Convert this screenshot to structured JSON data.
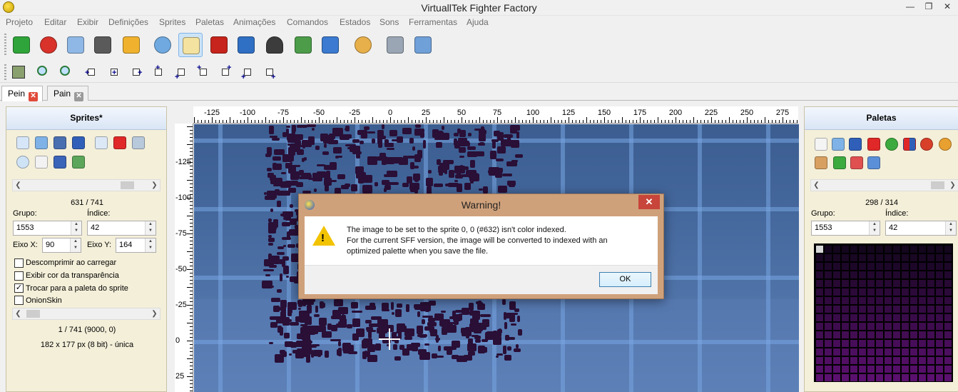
{
  "window": {
    "title": "VirtuallTek Fighter Factory",
    "min_label": "—",
    "max_label": "❐",
    "close_label": "✕"
  },
  "menu": [
    "Projeto",
    "Editar",
    "Exibir",
    "Definições",
    "Sprites",
    "Paletas",
    "Animações",
    "Comandos",
    "Estados",
    "Sons",
    "Ferramentas",
    "Ajuda"
  ],
  "toolbar": {
    "main_icons": [
      "new-icon",
      "close-project-icon",
      "open-icon",
      "save-icon",
      "lock-icon",
      "characters-icon",
      "sprite-editor-icon",
      "animation-clapper-icon",
      "window-icon",
      "joystick-icon",
      "sound-icon",
      "states-icon",
      "palette-icon",
      "tools-icon",
      "settings-icon"
    ],
    "secondary_icons": [
      "calculator-icon",
      "zoom-out-icon",
      "zoom-in-icon",
      "axis-left-icon",
      "axis-center-icon",
      "axis-right-icon",
      "axis-top-left-icon",
      "axis-bottom-left-icon",
      "axis-top-icon",
      "axis-top-right-icon",
      "axis-bottom-icon",
      "axis-bottom-right-icon"
    ]
  },
  "tabs": [
    {
      "label": "Pein",
      "active": true
    },
    {
      "label": "Pain",
      "active": false
    }
  ],
  "sprites_panel": {
    "title": "Sprites*",
    "counter": "631 / 741",
    "group_label": "Grupo:",
    "group_value": "1553",
    "index_label": "Índice:",
    "index_value": "42",
    "axis_x_label": "Eixo X:",
    "axis_x_value": "90",
    "axis_y_label": "Eixo Y:",
    "axis_y_value": "164",
    "checkboxes": [
      {
        "label": "Descomprimir ao carregar",
        "checked": false
      },
      {
        "label": "Exibir cor da transparência",
        "checked": false
      },
      {
        "label": "Trocar para a paleta do sprite",
        "checked": true
      },
      {
        "label": "OnionSkin",
        "checked": false
      }
    ],
    "onion_info": "1 / 741 (9000, 0)",
    "size_info": "182 x 177 px (8 bit) - única"
  },
  "palettes_panel": {
    "title": "Paletas",
    "counter": "298 / 314",
    "group_label": "Grupo:",
    "group_value": "1553",
    "index_label": "Índice:",
    "index_value": "42"
  },
  "rulers": {
    "top": [
      "-125",
      "-100",
      "-75",
      "-50",
      "-25",
      "0",
      "25",
      "50",
      "75",
      "100",
      "125",
      "150",
      "175",
      "200",
      "225",
      "250",
      "275"
    ],
    "left": [
      "-125",
      "-100",
      "-75",
      "-50",
      "-25",
      "0",
      "25"
    ]
  },
  "dialog": {
    "title": "Warning!",
    "close_label": "✕",
    "line1": "The image to be set to the sprite 0, 0 (#632) isn't color indexed.",
    "line2": "For the current SFF version, the image will be converted to indexed with an",
    "line3": "optimized palette when you save the file.",
    "ok_label": "OK"
  },
  "colors": {
    "panel_bg": "#f4efd9",
    "stage_bg": "#44679c",
    "sprite": "#2a0f36",
    "dialog_frame": "#cfa17b",
    "close_red": "#c7453a"
  }
}
